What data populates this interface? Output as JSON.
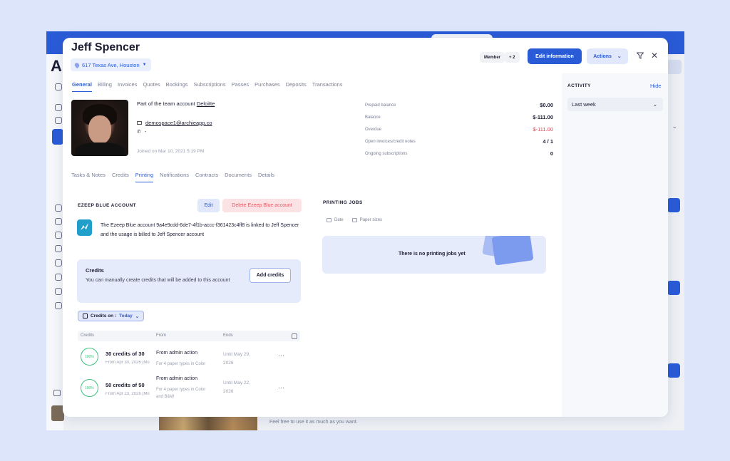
{
  "background": {
    "app_letter": "A",
    "footer_text": "Feel free to use it as much as you want."
  },
  "modal": {
    "title": "Jeff Spencer",
    "address": "617 Texas Ave, Houston",
    "badges": [
      "Member",
      "+ 2"
    ],
    "edit_button": "Edit information",
    "actions_button": "Actions",
    "tabs": [
      "General",
      "Billing",
      "Invoices",
      "Quotes",
      "Bookings",
      "Subscriptions",
      "Passes",
      "Purchases",
      "Deposits",
      "Transactions"
    ],
    "active_tab": 0,
    "profile": {
      "team_prefix": "Part of the team account",
      "team_name": "Deloitte",
      "email": "demospace1@archieapp.co",
      "phone": "-",
      "joined": "Joined on Mar 10, 2021 5:19 PM"
    },
    "stats": [
      {
        "label": "Prepaid balance",
        "value": "$0.00",
        "red": false
      },
      {
        "label": "Balance",
        "value": "$-111.00",
        "red": false
      },
      {
        "label": "Overdue",
        "value": "$-111.00",
        "red": true
      },
      {
        "label": "Open invoices/credit notes",
        "value": "4 / 1",
        "red": false
      },
      {
        "label": "Ongoing subscriptions",
        "value": "0",
        "red": false
      }
    ],
    "subtabs": [
      "Tasks & Notes",
      "Credits",
      "Printing",
      "Notifications",
      "Contracts",
      "Documents",
      "Details"
    ],
    "active_subtab": 2
  },
  "ezeep": {
    "title": "EZEEP BLUE ACCOUNT",
    "edit": "Edit",
    "delete": "Delete Ezeep Blue account",
    "description": "The Ezeep Blue account 9a4e9cdd-6de7-4f1b-accc-f361423c4ff8 is linked to Jeff Spencer and the usage is billed to Jeff Spencer account"
  },
  "credits": {
    "title": "Credits",
    "description": "You can manually create credits that will be added to this account",
    "add_button": "Add credits",
    "filter_label": "Credits on :",
    "filter_value": "Today",
    "columns": [
      "Credits",
      "From",
      "Ends"
    ],
    "rows": [
      {
        "percent": "100%",
        "title": "30 credits of 30",
        "sub": "From Apr 30, 2026 (Mo",
        "from": "From admin action",
        "from_sub": "For 4 paper types in Color",
        "ends": "Until May 29, 2026"
      },
      {
        "percent": "100%",
        "title": "50 credits of 50",
        "sub": "From Apr 23, 2026 (Mo",
        "from": "From admin action",
        "from_sub": "For 4 paper types in Color and B&W",
        "ends": "Until May 22, 2026"
      }
    ],
    "more": "···"
  },
  "printing": {
    "title": "PRINTING JOBS",
    "columns": [
      "Date",
      "Paper sizes"
    ],
    "empty": "There is no printing jobs yet"
  },
  "activity": {
    "title": "ACTIVITY",
    "hide": "Hide",
    "period": "Last week"
  },
  "colors": {
    "accent": "#2a5bd7",
    "danger": "#e05a66",
    "success": "#3cbf7c"
  }
}
